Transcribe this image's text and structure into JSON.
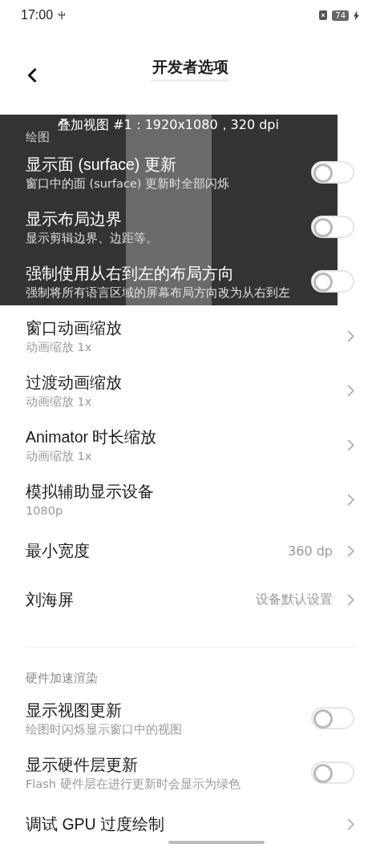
{
  "status_bar": {
    "time": "17:00",
    "battery": "74"
  },
  "header": {
    "title": "开发者选项"
  },
  "overlay": {
    "label": "叠加视图 #1：1920x1080，320 dpi"
  },
  "sections": [
    {
      "title": "绘图",
      "items": [
        {
          "kind": "toggle",
          "title": "显示面 (surface) 更新",
          "subtitle": "窗口中的面 (surface) 更新时全部闪烁",
          "on": false
        },
        {
          "kind": "toggle",
          "title": "显示布局边界",
          "subtitle": "显示剪辑边界、边距等。",
          "on": false
        },
        {
          "kind": "toggle",
          "title": "强制使用从右到左的布局方向",
          "subtitle": "强制将所有语言区域的屏幕布局方向改为从右到左",
          "on": false
        },
        {
          "kind": "link",
          "title": "窗口动画缩放",
          "subtitle": "动画缩放 1x"
        },
        {
          "kind": "link",
          "title": "过渡动画缩放",
          "subtitle": "动画缩放 1x"
        },
        {
          "kind": "link",
          "title": "Animator 时长缩放",
          "subtitle": "动画缩放 1x"
        },
        {
          "kind": "link",
          "title": "模拟辅助显示设备",
          "subtitle": "1080p"
        },
        {
          "kind": "link",
          "title": "最小宽度",
          "value": "360 dp"
        },
        {
          "kind": "link",
          "title": "刘海屏",
          "value": "设备默认设置"
        }
      ]
    },
    {
      "title": "硬件加速渲染",
      "items": [
        {
          "kind": "toggle",
          "title": "显示视图更新",
          "subtitle": "绘图时闪烁显示窗口中的视图",
          "on": false
        },
        {
          "kind": "toggle",
          "title": "显示硬件层更新",
          "subtitle": "Flash 硬件层在进行更新时会显示为绿色",
          "on": false
        },
        {
          "kind": "link",
          "title": "调试 GPU 过度绘制"
        }
      ]
    }
  ]
}
